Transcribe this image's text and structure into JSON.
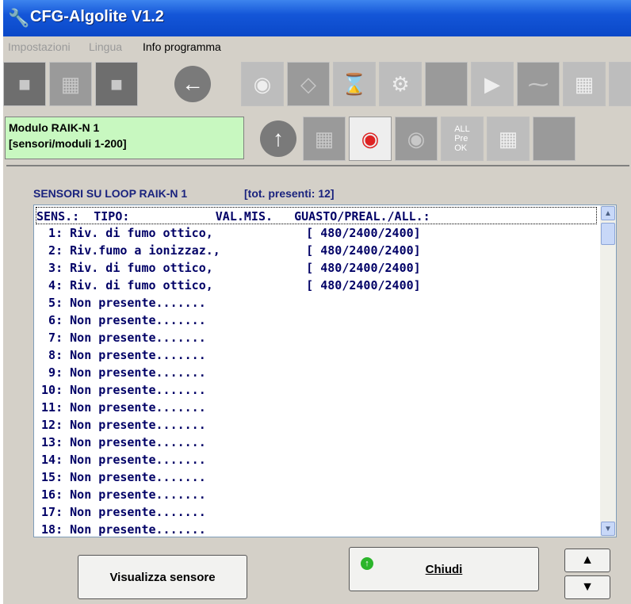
{
  "window": {
    "title": "CFG-Algolite V1.2"
  },
  "menu": [
    {
      "label": "Impostazioni",
      "enabled": false
    },
    {
      "label": "Lingua",
      "enabled": false
    },
    {
      "label": "Info programma",
      "enabled": true
    }
  ],
  "module": {
    "line1": "Modulo RAIK-N 1",
    "line2": "[sensori/moduli 1-200]"
  },
  "list": {
    "title": "SENSORI SU LOOP RAIK-N 1",
    "count": "[tot. presenti: 12]",
    "header": "SENS.:  TIPO:            VAL.MIS.   GUASTO/PREAL./ALL.:",
    "rows": [
      "  1: Riv. di fumo ottico,             [ 480/2400/2400]",
      "  2: Riv.fumo a ionizzaz.,            [ 480/2400/2400]",
      "  3: Riv. di fumo ottico,             [ 480/2400/2400]",
      "  4: Riv. di fumo ottico,             [ 480/2400/2400]",
      "  5: Non presente.......",
      "  6: Non presente.......",
      "  7: Non presente.......",
      "  8: Non presente.......",
      "  9: Non presente.......",
      " 10: Non presente.......",
      " 11: Non presente.......",
      " 12: Non presente.......",
      " 13: Non presente.......",
      " 14: Non presente.......",
      " 15: Non presente.......",
      " 16: Non presente.......",
      " 17: Non presente.......",
      " 18: Non presente......."
    ]
  },
  "buttons": {
    "view_sensor": "Visualizza sensore",
    "close": "Chiudi"
  },
  "icons": {
    "app": "wrench-icon",
    "toolbar1": [
      "print-icon",
      "config-icon",
      "save-icon",
      "back-arrow-icon",
      "sensors-icon",
      "modules-icon",
      "hourglass-icon",
      "tools-icon",
      "blank-icon",
      "output-icon",
      "switch-icon",
      "network-icon",
      "baud-icon"
    ],
    "toolbar2": [
      "up-arrow-icon",
      "sensor-config-icon",
      "sensor-view-icon",
      "sensor-single-icon",
      "alarm-levels-icon",
      "grid-icon",
      "blank-icon"
    ]
  },
  "colors": {
    "title_bar": "#0a48c8",
    "module_bg": "#c8f8c0",
    "list_text": "#000066",
    "ok_icon": "#2bb52b"
  }
}
